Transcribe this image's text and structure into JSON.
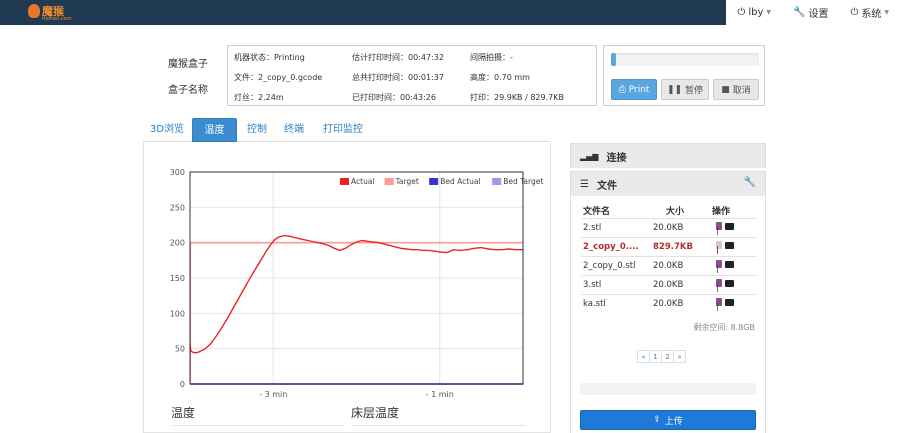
{
  "navbar": {
    "brand": "魔猴",
    "brand_sub": "mohou.com",
    "user_label": "lby",
    "settings_label": "设置",
    "system_label": "系统"
  },
  "box": {
    "name_label": "魔猴盒子",
    "box_name_label": "盒子名称"
  },
  "info": {
    "machine_state_label": "机器状态：",
    "machine_state_value": "Printing",
    "est_time_label": "估计打印时间：",
    "est_time_value": "00:47:32",
    "timelapse_label": "间隔拍摄：",
    "timelapse_value": "-",
    "file_label": "文件：",
    "file_value": "2_copy_0.gcode",
    "total_time_label": "总共打印时间：",
    "total_time_value": "00:01:37",
    "height_label": "高度：",
    "height_value": "0.70 mm",
    "filament_label": "灯丝：",
    "filament_value": "2.24m",
    "printed_time_label": "已打印时间：",
    "printed_time_value": "00:43:26",
    "print_label": "打印：",
    "print_value": "29.9KB / 829.7KB"
  },
  "controls": {
    "print_label": "Print",
    "pause_label": "暂停",
    "cancel_label": "取消",
    "print_progress": 0.036
  },
  "tabs": [
    "3D浏览",
    "温度",
    "控制",
    "终端",
    "打印监控"
  ],
  "active_tab": 1,
  "chart_data": {
    "type": "line",
    "title": "",
    "xlabel": "",
    "ylabel": "",
    "ylim": [
      0,
      300
    ],
    "yticks": [
      0,
      50,
      100,
      150,
      200,
      250,
      300
    ],
    "x_tick_labels": [
      "- 3 min",
      "- 1 min"
    ],
    "xlim": [
      -240,
      0
    ],
    "grid": true,
    "legend_position": "top-right",
    "series": [
      {
        "name": "Actual",
        "color": "#ee2222",
        "x": [
          -240,
          -239.5,
          -238,
          -236,
          -234,
          -232,
          -229,
          -225,
          -221,
          -217,
          -213,
          -209,
          -205,
          -201,
          -197,
          -193,
          -189,
          -185,
          -182,
          -179,
          -176,
          -172,
          -168,
          -164,
          -160,
          -155,
          -150,
          -145,
          -140,
          -136,
          -132,
          -128,
          -124,
          -120,
          -116,
          -112,
          -108,
          -104,
          -100,
          -96,
          -92,
          -88,
          -84,
          -80,
          -76,
          -72,
          -68,
          -64,
          -60,
          -55,
          -50,
          -45,
          -40,
          -35,
          -30,
          -25,
          -20,
          -15,
          -10,
          -5,
          0
        ],
        "y": [
          56,
          47,
          45,
          44,
          45,
          47,
          50,
          57,
          68,
          80,
          93,
          107,
          121,
          135,
          149,
          162,
          175,
          188,
          197,
          204,
          208,
          210,
          209,
          207,
          205,
          203,
          201,
          199,
          196,
          192,
          189,
          192,
          197,
          201,
          203,
          202,
          201,
          200,
          198,
          196,
          194,
          192,
          191,
          190,
          190,
          189,
          189,
          188,
          187,
          186,
          190,
          189,
          190,
          192,
          193,
          191,
          190,
          190,
          191,
          190,
          190
        ]
      },
      {
        "name": "Target",
        "color": "#ff9999",
        "x": [
          -240,
          -239.8,
          -239.8,
          0
        ],
        "y": [
          0,
          0,
          200,
          200
        ]
      },
      {
        "name": "Bed Actual",
        "color": "#3333dd",
        "x": [
          -240,
          0
        ],
        "y": [
          0,
          0
        ]
      },
      {
        "name": "Bed Target",
        "color": "#9999ee",
        "x": [
          -240,
          0
        ],
        "y": [
          0,
          0
        ]
      }
    ]
  },
  "subpanels": {
    "temp_title": "温度",
    "bed_title": "床层温度"
  },
  "connection": {
    "title": "连接"
  },
  "files": {
    "title": "文件",
    "col_name": "文件名",
    "col_size": "大小",
    "col_ops": "操作",
    "rows": [
      {
        "name": "2.stl",
        "size": "20.0KB",
        "selected": false
      },
      {
        "name": "2_copy_0....",
        "size": "829.7KB",
        "selected": true
      },
      {
        "name": "2_copy_0.stl",
        "size": "20.0KB",
        "selected": false
      },
      {
        "name": "3.stl",
        "size": "20.0KB",
        "selected": false
      },
      {
        "name": "ka.stl",
        "size": "20.0KB",
        "selected": false
      }
    ],
    "free_space": "剩余空间: 8.8GB",
    "pages": [
      "«",
      "1",
      "2",
      "»"
    ],
    "upload_label": "上传"
  },
  "colors": {
    "navbar_bg": "#1f3a52",
    "primary_blue": "#3c8dd0",
    "upload_blue": "#1e7ad6",
    "selected_file": "#b03030"
  }
}
